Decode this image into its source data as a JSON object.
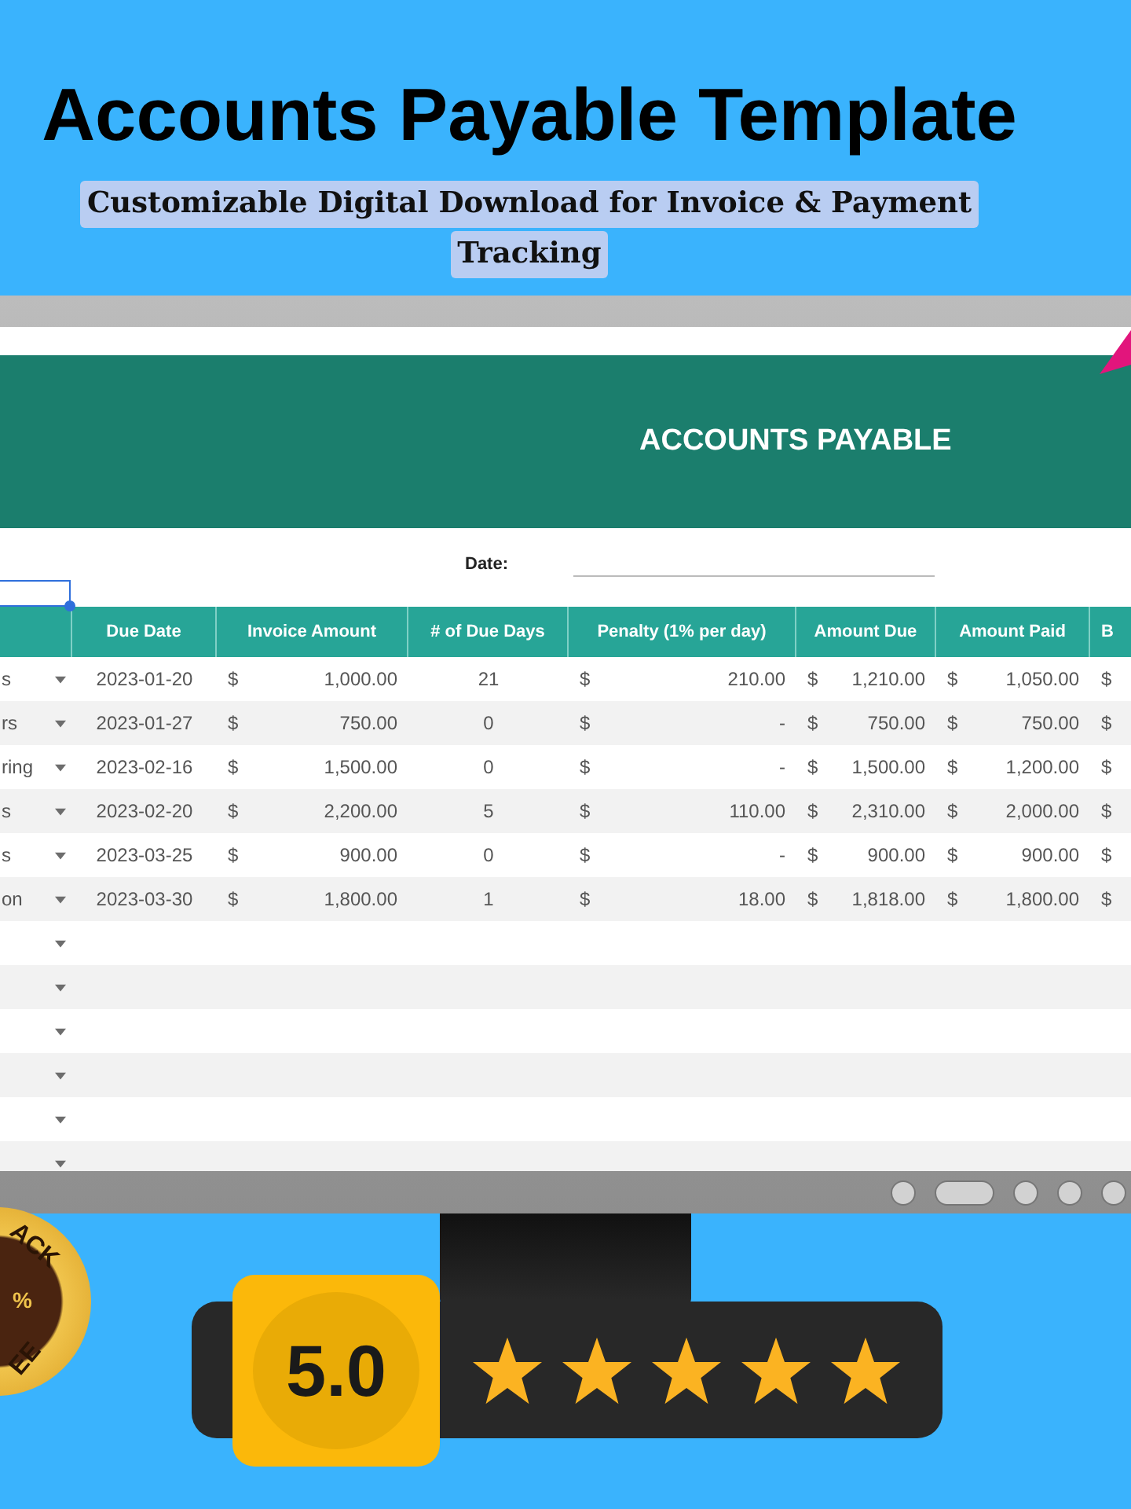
{
  "title": "Accounts Payable Template",
  "subtitle_lines": [
    "Customizable Digital Download for Invoice & Payment",
    "Tracking"
  ],
  "sheet": {
    "heading": "ACCOUNTS PAYABLE",
    "date_label": "Date:",
    "active_cell": {
      "selected": true
    },
    "columns": [
      {
        "kind": "dropdown"
      },
      {
        "label": "Due Date",
        "kind": "center"
      },
      {
        "label": "Invoice Amount",
        "kind": "money"
      },
      {
        "label": "# of Due Days",
        "kind": "center"
      },
      {
        "label": "Penalty (1% per day)",
        "kind": "money"
      },
      {
        "label": "Amount Due",
        "kind": "money"
      },
      {
        "label": "Amount Paid",
        "kind": "money"
      },
      {
        "label": "B",
        "kind": "money"
      }
    ],
    "rows": [
      {
        "cells": [
          {
            "text": "s"
          },
          {
            "text": "2023-01-20"
          },
          {
            "symbol": "$",
            "amount": "1,000.00"
          },
          {
            "text": "21"
          },
          {
            "symbol": "$",
            "amount": "210.00"
          },
          {
            "symbol": "$",
            "amount": "1,210.00"
          },
          {
            "symbol": "$",
            "amount": "1,050.00"
          },
          {
            "symbol": "$"
          }
        ]
      },
      {
        "cells": [
          {
            "text": "rs"
          },
          {
            "text": "2023-01-27"
          },
          {
            "symbol": "$",
            "amount": "750.00"
          },
          {
            "text": "0"
          },
          {
            "symbol": "$",
            "amount": "-"
          },
          {
            "symbol": "$",
            "amount": "750.00"
          },
          {
            "symbol": "$",
            "amount": "750.00"
          },
          {
            "symbol": "$"
          }
        ]
      },
      {
        "cells": [
          {
            "text": "ring"
          },
          {
            "text": "2023-02-16"
          },
          {
            "symbol": "$",
            "amount": "1,500.00"
          },
          {
            "text": "0"
          },
          {
            "symbol": "$",
            "amount": "-"
          },
          {
            "symbol": "$",
            "amount": "1,500.00"
          },
          {
            "symbol": "$",
            "amount": "1,200.00"
          },
          {
            "symbol": "$"
          }
        ]
      },
      {
        "cells": [
          {
            "text": "s"
          },
          {
            "text": "2023-02-20"
          },
          {
            "symbol": "$",
            "amount": "2,200.00"
          },
          {
            "text": "5"
          },
          {
            "symbol": "$",
            "amount": "110.00"
          },
          {
            "symbol": "$",
            "amount": "2,310.00"
          },
          {
            "symbol": "$",
            "amount": "2,000.00"
          },
          {
            "symbol": "$"
          }
        ]
      },
      {
        "cells": [
          {
            "text": "s"
          },
          {
            "text": "2023-03-25"
          },
          {
            "symbol": "$",
            "amount": "900.00"
          },
          {
            "text": "0"
          },
          {
            "symbol": "$",
            "amount": "-"
          },
          {
            "symbol": "$",
            "amount": "900.00"
          },
          {
            "symbol": "$",
            "amount": "900.00"
          },
          {
            "symbol": "$"
          }
        ]
      },
      {
        "cells": [
          {
            "text": "on"
          },
          {
            "text": "2023-03-30"
          },
          {
            "symbol": "$",
            "amount": "1,800.00"
          },
          {
            "text": "1"
          },
          {
            "symbol": "$",
            "amount": "18.00"
          },
          {
            "symbol": "$",
            "amount": "1,818.00"
          },
          {
            "symbol": "$",
            "amount": "1,800.00"
          },
          {
            "symbol": "$"
          }
        ]
      },
      {
        "cells": [
          {}
        ]
      },
      {
        "cells": [
          {}
        ]
      },
      {
        "cells": [
          {}
        ]
      },
      {
        "cells": [
          {}
        ]
      },
      {
        "cells": [
          {}
        ]
      },
      {
        "cells": [
          {}
        ]
      }
    ]
  },
  "seal": {
    "texts": [
      "ACK",
      "%",
      "EE"
    ]
  },
  "rating": {
    "score": "5.0",
    "stars": 5
  }
}
